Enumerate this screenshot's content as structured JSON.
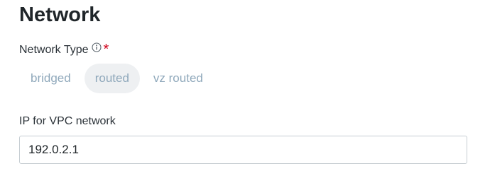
{
  "section": {
    "title": "Network"
  },
  "network_type": {
    "label": "Network Type",
    "required_mark": "*",
    "info_icon": "info-circle-icon",
    "options": [
      {
        "label": "bridged",
        "selected": false
      },
      {
        "label": "routed",
        "selected": true
      },
      {
        "label": "vz routed",
        "selected": false
      }
    ]
  },
  "ip_field": {
    "label": "IP for VPC network",
    "value": "192.0.2.1"
  },
  "colors": {
    "required": "#d0021b",
    "option_text": "#8fa8bb",
    "option_selected_bg": "#eef0f2",
    "input_border": "#c6cdd2"
  }
}
